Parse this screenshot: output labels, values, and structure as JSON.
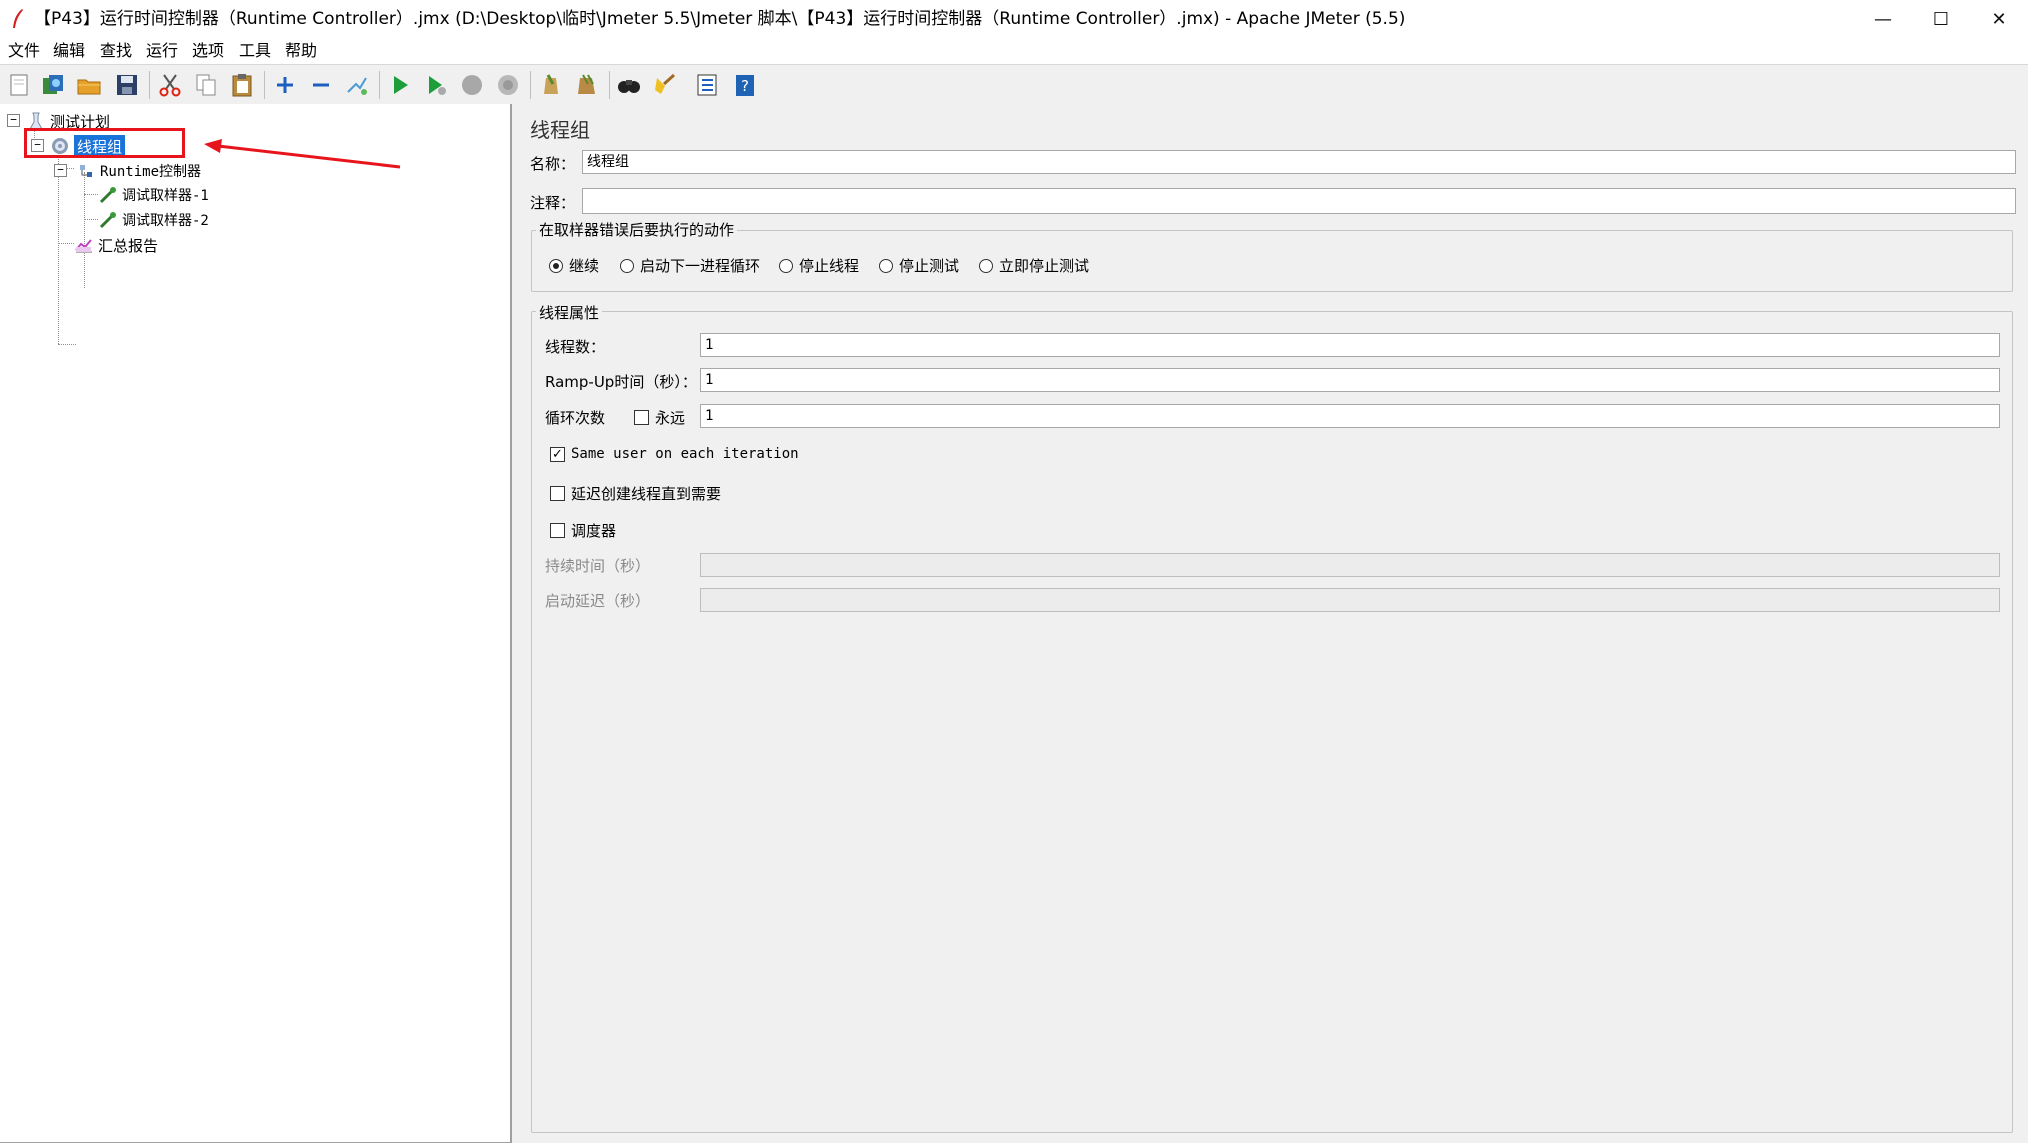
{
  "window": {
    "title": "【P43】运行时间控制器（Runtime Controller）.jmx (D:\\Desktop\\临时\\Jmeter 5.5\\Jmeter 脚本\\【P43】运行时间控制器（Runtime Controller）.jmx) - Apache JMeter (5.5)",
    "minimize": "—",
    "maximize": "☐",
    "close": "✕"
  },
  "menu": [
    "文件",
    "编辑",
    "查找",
    "运行",
    "选项",
    "工具",
    "帮助"
  ],
  "toolbar": [
    "new-icon",
    "templates-icon",
    "open-icon",
    "save-icon",
    "cut-icon",
    "copy-icon",
    "paste-icon",
    "expand-icon",
    "collapse-icon",
    "toggle-icon",
    "start-icon",
    "start-no-pause-icon",
    "stop-icon",
    "shutdown-icon",
    "clear-icon",
    "clear-all-icon",
    "search-icon",
    "reset-search-icon",
    "function-helper-icon",
    "help-icon"
  ],
  "tree": {
    "test_plan": "测试计划",
    "thread_group": "线程组",
    "runtime_controller": "Runtime控制器",
    "debug_sampler_1": "调试取样器-1",
    "debug_sampler_2": "调试取样器-2",
    "summary_report": "汇总报告",
    "toggle_expanded": "−"
  },
  "panel": {
    "title": "线程组",
    "name_label": "名称：",
    "name_value": "线程组",
    "comment_label": "注释：",
    "comment_value": "",
    "error_group_title": "在取样器错误后要执行的动作",
    "error_actions": [
      {
        "label": "继续",
        "selected": true
      },
      {
        "label": "启动下一进程循环",
        "selected": false
      },
      {
        "label": "停止线程",
        "selected": false
      },
      {
        "label": "停止测试",
        "selected": false
      },
      {
        "label": "立即停止测试",
        "selected": false
      }
    ],
    "props_group_title": "线程属性",
    "threads_label": "线程数：",
    "threads_value": "1",
    "rampup_label": "Ramp-Up时间（秒）：",
    "rampup_value": "1",
    "loop_label": "循环次数",
    "forever_label": "永远",
    "forever_checked": false,
    "loop_value": "1",
    "same_user_label": "Same user on each iteration",
    "same_user_checked": true,
    "delay_create_label": "延迟创建线程直到需要",
    "delay_create_checked": false,
    "scheduler_label": "调度器",
    "scheduler_checked": false,
    "duration_label": "持续时间（秒）",
    "duration_value": "",
    "startup_delay_label": "启动延迟（秒）",
    "startup_delay_value": ""
  },
  "colors": {
    "selection": "#1a73d8",
    "annotation": "#e8141b"
  }
}
